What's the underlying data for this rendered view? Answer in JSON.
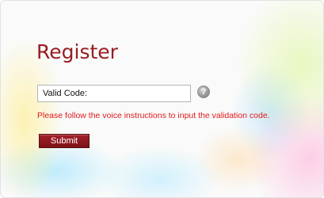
{
  "form": {
    "title": "Register",
    "code_field": {
      "value": "Valid Code:",
      "placeholder": ""
    },
    "help_icon": {
      "icon": "question-circle-icon",
      "glyph": "?"
    },
    "message": "Please follow the voice instructions to input the validation code.",
    "submit_label": "Submit"
  },
  "colors": {
    "title": "#9a1c22",
    "message": "#e01818",
    "button": "#8b1a20"
  }
}
